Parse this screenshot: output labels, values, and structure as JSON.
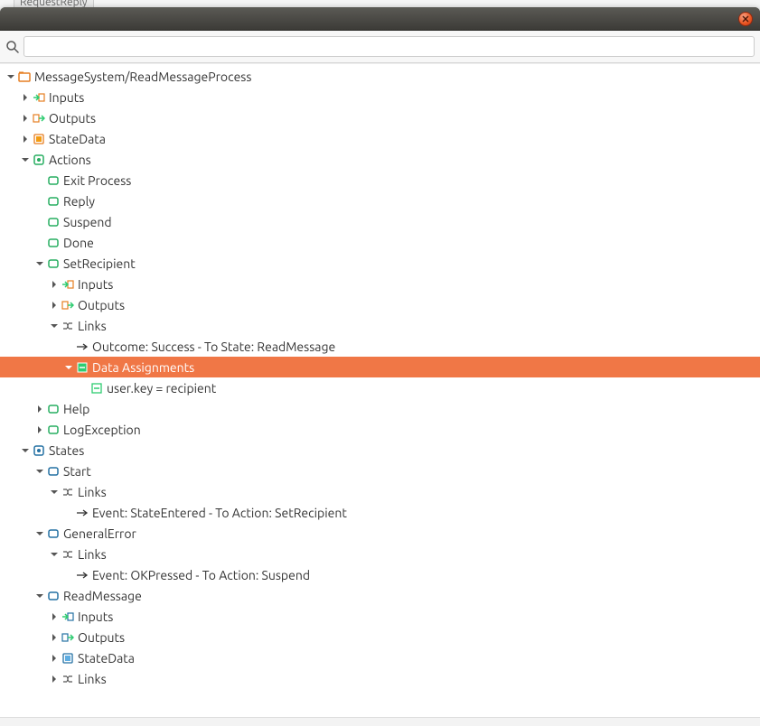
{
  "partial_tab": "RequestReply",
  "search": {
    "placeholder": ""
  },
  "icons": {
    "folder": "folder-icon",
    "input": "input-arrow-icon",
    "output": "output-arrow-icon",
    "statedata": "statedata-icon",
    "actions": "actions-icon",
    "action": "action-box-icon",
    "links": "links-icon",
    "arrow": "link-arrow-icon",
    "data_assign": "data-assignments-icon",
    "assign_item": "assignment-item-icon",
    "states": "states-icon",
    "state": "state-box-icon"
  },
  "tree": {
    "root": {
      "label": "MessageSystem/ReadMessageProcess"
    },
    "inputs": "Inputs",
    "outputs": "Outputs",
    "statedata": "StateData",
    "actions": {
      "label": "Actions",
      "exit_process": "Exit Process",
      "reply": "Reply",
      "suspend": "Suspend",
      "done": "Done",
      "set_recipient": {
        "label": "SetRecipient",
        "inputs": "Inputs",
        "outputs": "Outputs",
        "links": {
          "label": "Links",
          "outcome": "Outcome: Success - To State: ReadMessage",
          "data_assignments": {
            "label": "Data Assignments",
            "item": "user.key = recipient"
          }
        }
      },
      "help": "Help",
      "log_exception": "LogException"
    },
    "states": {
      "label": "States",
      "start": {
        "label": "Start",
        "links": {
          "label": "Links",
          "event": "Event: StateEntered - To Action: SetRecipient"
        }
      },
      "general_error": {
        "label": "GeneralError",
        "links": {
          "label": "Links",
          "event": "Event: OKPressed - To Action: Suspend"
        }
      },
      "read_message": {
        "label": "ReadMessage",
        "inputs": "Inputs",
        "outputs": "Outputs",
        "statedata": "StateData",
        "links": "Links"
      }
    }
  }
}
